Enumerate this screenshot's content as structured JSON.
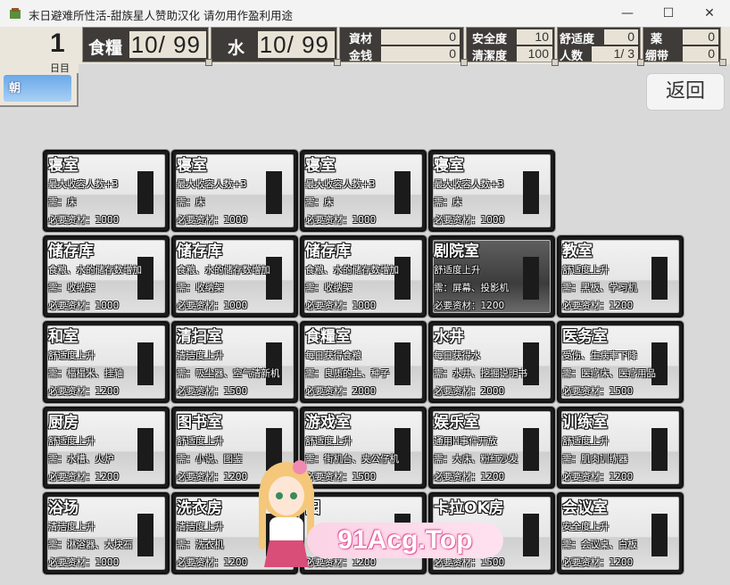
{
  "window": {
    "title": "末日避难所性活-甜族星人赞助汉化 请勿用作盈利用途",
    "minimize_glyph": "—",
    "maximize_glyph": "☐",
    "close_glyph": "✕"
  },
  "hud": {
    "day_number": "1",
    "day_unit": "日目",
    "time_label": "朝",
    "food_label": "食糧",
    "food_value": "10/ 99",
    "water_label": "水",
    "water_value": "10/ 99",
    "materials_label": "資材",
    "materials_value": "0",
    "money_label": "金钱",
    "money_value": "0",
    "safety_label": "安全度",
    "safety_value": "10",
    "cleanliness_label": "清潔度",
    "cleanliness_value": "100",
    "comfort_label": "舒适度",
    "comfort_value": "0",
    "people_label": "人数",
    "people_value": "1/ 3",
    "medicine_label": "薬",
    "medicine_value": "0",
    "bandage_label": "绷带",
    "bandage_value": "0"
  },
  "back_button": {
    "label": "返回"
  },
  "rooms": [
    {
      "name": "寝室",
      "l1": "最大收容人数+3",
      "l2": "需：床",
      "l3": "必要资材：1000",
      "style": "light"
    },
    {
      "name": "寝室",
      "l1": "最大收容人数+3",
      "l2": "需：床",
      "l3": "必要资材：1000",
      "style": "light"
    },
    {
      "name": "寝室",
      "l1": "最大收容人数+3",
      "l2": "需：床",
      "l3": "必要资材：1000",
      "style": "light"
    },
    {
      "name": "寝室",
      "l1": "最大收容人数+3",
      "l2": "需：床",
      "l3": "必要资材：1000",
      "style": "light"
    },
    {
      "name": "储存库",
      "l1": "食粮、水的储存数增加",
      "l2": "需：收纳架",
      "l3": "必要资材：1000",
      "style": "light"
    },
    {
      "name": "储存库",
      "l1": "食粮、水的储存数增加",
      "l2": "需：收纳架",
      "l3": "必要资材：1000",
      "style": "light"
    },
    {
      "name": "储存库",
      "l1": "食粮、水的储存数增加",
      "l2": "需：收纳架",
      "l3": "必要资材：1000",
      "style": "light"
    },
    {
      "name": "剧院室",
      "l1": "舒适度上升",
      "l2": "需：屏幕、投影机",
      "l3": "必要资材：1200",
      "style": "dark"
    },
    {
      "name": "教室",
      "l1": "舒适度上升",
      "l2": "需：黑板、学习机",
      "l3": "必要资材：1200",
      "style": "light"
    },
    {
      "name": "和室",
      "l1": "舒适度上升",
      "l2": "需：榻榻米、挂轴",
      "l3": "必要资材：1200",
      "style": "light"
    },
    {
      "name": "清扫室",
      "l1": "清洁度上升",
      "l2": "需：吸尘器、空气清新机",
      "l3": "必要资材：1500",
      "style": "light"
    },
    {
      "name": "食糧室",
      "l1": "每日获得食粮",
      "l2": "需：良质的土、种子",
      "l3": "必要资材：2000",
      "style": "light"
    },
    {
      "name": "水井",
      "l1": "每日获得水",
      "l2": "需：水井、挖掘说明书",
      "l3": "必要资材：2000",
      "style": "light"
    },
    {
      "name": "医务室",
      "l1": "受伤、生病率下降",
      "l2": "需：医疗床、医疗用品",
      "l3": "必要资材：1500",
      "style": "light"
    },
    {
      "name": "厨房",
      "l1": "舒适度上升",
      "l2": "需：水槽、火炉",
      "l3": "必要资材：1200",
      "style": "light"
    },
    {
      "name": "图书室",
      "l1": "舒适度上升",
      "l2": "需：小说、图鉴",
      "l3": "必要资材：1200",
      "style": "light"
    },
    {
      "name": "游戏室",
      "l1": "舒适度上升",
      "l2": "需：街机台、夹公仔机",
      "l3": "必要资材：1500",
      "style": "light"
    },
    {
      "name": "娱乐室",
      "l1": "通用H事件开放",
      "l2": "需：大床、粉红沙发",
      "l3": "必要资材：1200",
      "style": "light"
    },
    {
      "name": "训练室",
      "l1": "舒适度上升",
      "l2": "需：肌肉训练器",
      "l3": "必要资材：1200",
      "style": "light"
    },
    {
      "name": "浴场",
      "l1": "清洁度上升",
      "l2": "需：淋浴器、大块石",
      "l3": "必要资材：1000",
      "style": "light"
    },
    {
      "name": "洗衣房",
      "l1": "清洁度上升",
      "l2": "需：洗衣机",
      "l3": "必要资材：1200",
      "style": "light"
    },
    {
      "name": "园",
      "l1": "",
      "l2": "",
      "l3": "必要资材：1200",
      "style": "light"
    },
    {
      "name": "卡拉OK房",
      "l1": "",
      "l2": "卡拉OK机",
      "l3": "必要资材：1500",
      "style": "light"
    },
    {
      "name": "会议室",
      "l1": "安全度上升",
      "l2": "需：会议桌、白板",
      "l3": "必要资材：1200",
      "style": "light"
    }
  ],
  "watermark": {
    "text": "91Acg.Top"
  }
}
